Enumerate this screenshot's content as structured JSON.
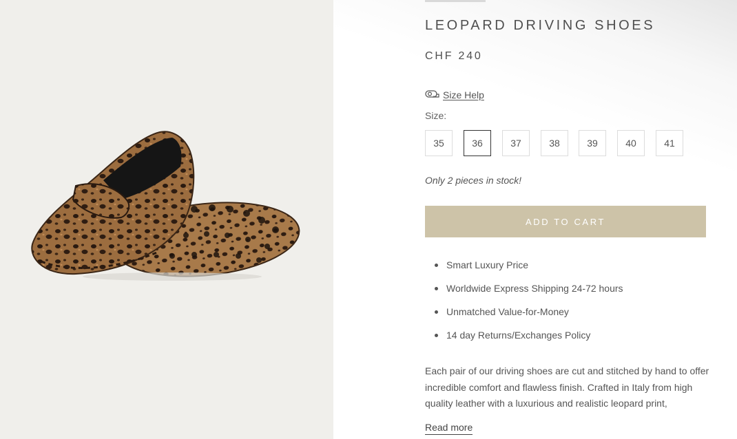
{
  "product": {
    "title": "LEOPARD DRIVING SHOES",
    "price": "CHF 240",
    "image_alt": "leopard-print driving loafers pair"
  },
  "size_help": {
    "label": "Size Help",
    "icon": "ruler-tape-icon"
  },
  "size_selector": {
    "label": "Size:",
    "options": [
      "35",
      "36",
      "37",
      "38",
      "39",
      "40",
      "41"
    ],
    "selected": "36"
  },
  "stock_message": "Only 2 pieces in stock!",
  "cart": {
    "add_label": "ADD TO CART",
    "button_color": "#cdc3a8"
  },
  "features": [
    "Smart Luxury Price",
    "Worldwide Express Shipping 24-72 hours",
    "Unmatched Value-for-Money",
    "14 day Returns/Exchanges Policy"
  ],
  "description": "Each pair of our driving shoes are cut and stitched by hand to offer incredible comfort and flawless finish. Crafted in Italy from high quality leather with a luxurious and realistic leopard print,",
  "read_more_label": "Read more",
  "colors": {
    "left_panel_bg": "#f0efeb",
    "text": "#555555",
    "selected_border": "#333333"
  }
}
